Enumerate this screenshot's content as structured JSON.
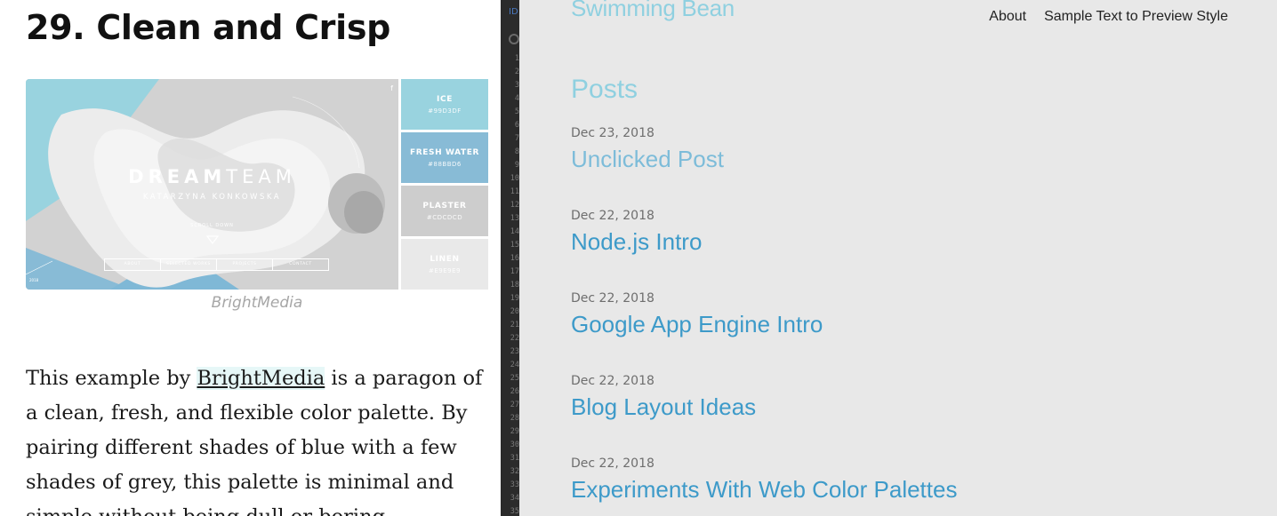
{
  "article": {
    "heading": "29. Clean and Crisp",
    "figure": {
      "screenshot": {
        "title_bold": "DREAM",
        "title_light": "TEAM",
        "subtitle": "KATARZYNA KONKOWSKA",
        "scroll_text": "SCROLL DOWN",
        "nav": [
          "ABOUT",
          "SELECTED WORKS",
          "PROJECTS",
          "CONTACT"
        ],
        "social_icon": "facebook-icon"
      },
      "swatches": [
        {
          "name": "ICE",
          "hex": "#99D3DF"
        },
        {
          "name": "FRESH WATER",
          "hex": "#88BBD6"
        },
        {
          "name": "PLASTER",
          "hex": "#CDCDCD"
        },
        {
          "name": "LINEN",
          "hex": "#E9E9E9"
        }
      ],
      "caption": "BrightMedia"
    },
    "paragraph": {
      "before_link": "This example by ",
      "link": "BrightMedia",
      "after_link": " is a paragon of a clean, fresh, and flexible color palette. By pairing different shades of blue with a few shades of grey, this palette is minimal and simple without being dull or boring."
    }
  },
  "editor": {
    "tab_label": "ID",
    "line_numbers": [
      "1",
      "2",
      "3",
      "4",
      "5",
      "6",
      "7",
      "8",
      "9",
      "10",
      "11",
      "12",
      "13",
      "14",
      "15",
      "16",
      "17",
      "18",
      "19",
      "20",
      "21",
      "22",
      "23",
      "24",
      "25",
      "26",
      "27",
      "28",
      "29",
      "30",
      "31",
      "32",
      "33",
      "34",
      "35"
    ]
  },
  "blog": {
    "brand": "Swimming Bean",
    "nav": {
      "about": "About",
      "sample": "Sample Text to Preview Style"
    },
    "section_heading": "Posts",
    "posts": [
      {
        "date": "Dec 23, 2018",
        "title": "Unclicked Post"
      },
      {
        "date": "Dec 22, 2018",
        "title": "Node.js Intro"
      },
      {
        "date": "Dec 22, 2018",
        "title": "Google App Engine Intro"
      },
      {
        "date": "Dec 22, 2018",
        "title": "Blog Layout Ideas"
      },
      {
        "date": "Dec 22, 2018",
        "title": "Experiments With Web Color Palettes"
      }
    ],
    "colors": {
      "background": "#e8e8e8",
      "brand": "#8fd0e0",
      "post_title": "#3d9ac9",
      "date": "#6e6e6e"
    }
  }
}
